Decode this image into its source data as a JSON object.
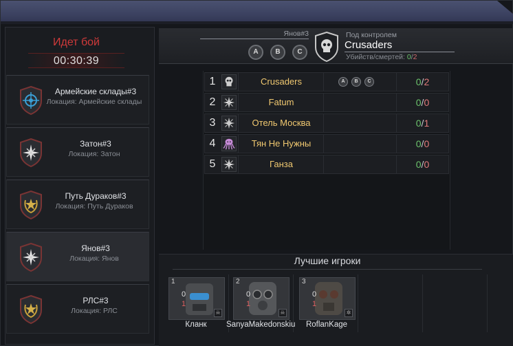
{
  "battle": {
    "status": "Идет бой",
    "timer": "00:30:39"
  },
  "locations": [
    {
      "title": "Армейские склады#3",
      "subtitle": "Локация: Армейские склады",
      "emblem": "blue-crosshair-shield-icon",
      "active": false
    },
    {
      "title": "Затон#3",
      "subtitle": "Локация: Затон",
      "emblem": "star-shield-icon",
      "active": false
    },
    {
      "title": "Путь Дураков#3",
      "subtitle": "Локация: Путь Дураков",
      "emblem": "gold-wreath-shield-icon",
      "active": false
    },
    {
      "title": "Янов#3",
      "subtitle": "Локация: Янов",
      "emblem": "star-shield-icon",
      "active": true
    },
    {
      "title": "РЛС#3",
      "subtitle": "Локация: РЛС",
      "emblem": "gold-wreath-shield-icon",
      "active": false
    }
  ],
  "header": {
    "location": "Янов#3",
    "slots": [
      "A",
      "B",
      "C"
    ],
    "control_label": "Под контролем",
    "control_clan": "Crusaders",
    "kd_label": "Убийств/смертей:",
    "kills": "0",
    "slash": "/",
    "deaths": "2"
  },
  "clans": [
    {
      "rank": "1",
      "name": "Crusaders",
      "emblem": "skull-icon",
      "kills": "0",
      "deaths": "2",
      "slots": [
        "A",
        "B",
        "C"
      ]
    },
    {
      "rank": "2",
      "name": "Fatum",
      "emblem": "compass-star-icon",
      "kills": "0",
      "deaths": "0"
    },
    {
      "rank": "3",
      "name": "Отель Москва",
      "emblem": "compass-star-icon",
      "kills": "0",
      "deaths": "1"
    },
    {
      "rank": "4",
      "name": "Тян Не Нужны",
      "emblem": "octopus-icon",
      "kills": "0",
      "deaths": "0"
    },
    {
      "rank": "5",
      "name": "Ганза",
      "emblem": "compass-star-icon",
      "kills": "0",
      "deaths": "0"
    }
  ],
  "best_players": {
    "title": "Лучшие игроки",
    "players": [
      {
        "rank": "1",
        "name": "Кланк",
        "kills": "0",
        "deaths": "1",
        "badge": "skull-badge-icon"
      },
      {
        "rank": "2",
        "name": "SanyaMakedonskiu",
        "kills": "0",
        "deaths": "1",
        "badge": "skull-badge-icon"
      },
      {
        "rank": "3",
        "name": "RoflanKage",
        "kills": "0",
        "deaths": "1",
        "badge": "star-badge-icon"
      }
    ]
  },
  "colors": {
    "status_red": "#d03a3a",
    "clan_gold": "#f0c870",
    "kills_green": "#6cc36c",
    "deaths_red": "#e07a7a",
    "titlebar": "#3b4160"
  }
}
